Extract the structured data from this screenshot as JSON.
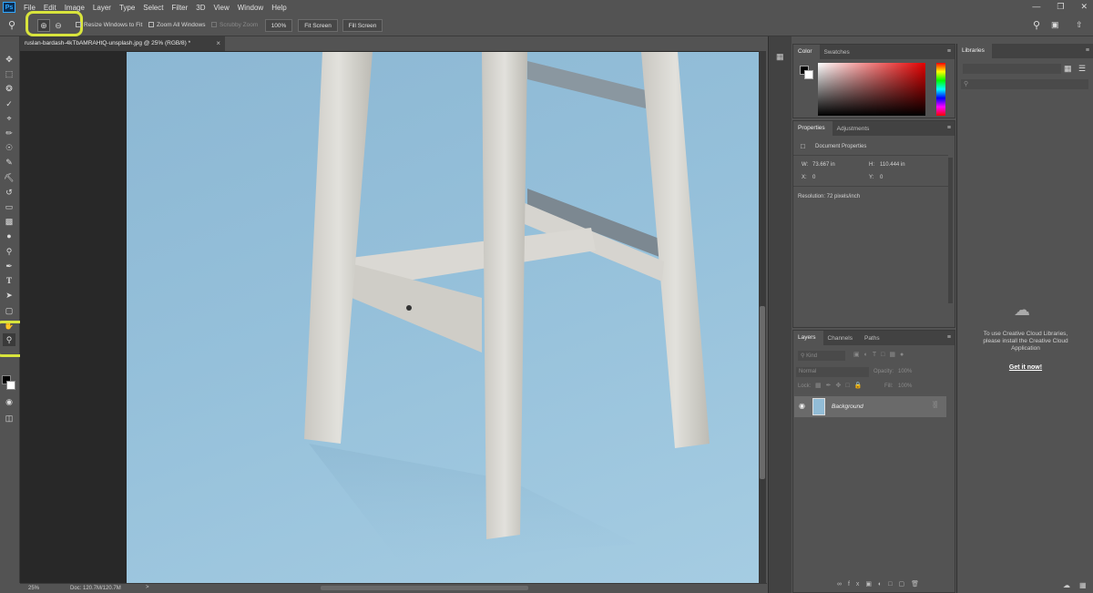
{
  "menu": {
    "app_logo": "Ps",
    "items": [
      "File",
      "Edit",
      "Image",
      "Layer",
      "Type",
      "Select",
      "Filter",
      "3D",
      "View",
      "Window",
      "Help"
    ]
  },
  "options_bar": {
    "resize_windows": "Resize Windows to Fit",
    "zoom_all_windows": "Zoom All Windows",
    "scrubby_zoom": "Scrubby Zoom",
    "zoom_value": "100%",
    "fit_screen": "Fit Screen",
    "fill_screen": "Fill Screen"
  },
  "document": {
    "tab_title": "ruslan-bardash-4kTbAMRAHtQ-unsplash.jpg @ 25% (RGB/8) *",
    "close": "×"
  },
  "status_bar": {
    "zoom": "25%",
    "doc_info": "Doc: 120.7M/120.7M",
    "arrow": ">"
  },
  "color_panel": {
    "tabs": [
      "Color",
      "Swatches"
    ],
    "menu_icon": "≡"
  },
  "properties_panel": {
    "tabs": [
      "Properties",
      "Adjustments"
    ],
    "title": "Document Properties",
    "w_label": "W:",
    "w_value": "73.667 in",
    "h_label": "H:",
    "h_value": "110.444 in",
    "x_label": "X:",
    "x_value": "0",
    "y_label": "Y:",
    "y_value": "0",
    "resolution": "Resolution: 72 pixels/inch"
  },
  "layers_panel": {
    "tabs": [
      "Layers",
      "Channels",
      "Paths"
    ],
    "kind_label": "Kind",
    "blend_mode": "Normal",
    "opacity_label": "Opacity:",
    "opacity_value": "100%",
    "lock_label": "Lock:",
    "fill_label": "Fill:",
    "fill_value": "100%",
    "layer_name": "Background"
  },
  "libraries_panel": {
    "tab": "Libraries",
    "message": "To use Creative Cloud Libraries, please install the Creative Cloud Application",
    "link": "Get it now!"
  },
  "colors": {
    "highlight": "#d8e43c",
    "backdrop": "#95c0da",
    "stool": "#dcdcd8"
  }
}
